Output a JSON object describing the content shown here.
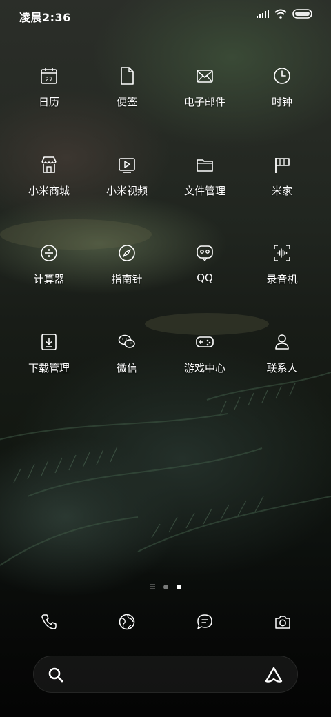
{
  "status_bar": {
    "time": "凌晨2:36",
    "icons": [
      "signal-icon",
      "wifi-icon",
      "battery-icon"
    ]
  },
  "apps": [
    {
      "label": "日历",
      "icon": "calendar-icon",
      "badge_text": "27"
    },
    {
      "label": "便签",
      "icon": "notes-icon"
    },
    {
      "label": "电子邮件",
      "icon": "email-icon"
    },
    {
      "label": "时钟",
      "icon": "clock-icon"
    },
    {
      "label": "小米商城",
      "icon": "mi-store-icon"
    },
    {
      "label": "小米视频",
      "icon": "video-icon"
    },
    {
      "label": "文件管理",
      "icon": "folder-icon"
    },
    {
      "label": "米家",
      "icon": "mijia-icon"
    },
    {
      "label": "计算器",
      "icon": "calculator-icon"
    },
    {
      "label": "指南针",
      "icon": "compass-icon"
    },
    {
      "label": "QQ",
      "icon": "qq-icon"
    },
    {
      "label": "录音机",
      "icon": "recorder-icon"
    },
    {
      "label": "下载管理",
      "icon": "download-icon"
    },
    {
      "label": "微信",
      "icon": "wechat-icon"
    },
    {
      "label": "游戏中心",
      "icon": "gamepad-icon"
    },
    {
      "label": "联系人",
      "icon": "contacts-icon"
    }
  ],
  "page_indicator": {
    "pages": 3,
    "active_index": 2
  },
  "dock": [
    "phone-icon",
    "browser-icon",
    "messages-icon",
    "camera-icon"
  ],
  "search_bar": {
    "left_icon": "search-icon",
    "right_icon": "assistant-icon"
  }
}
